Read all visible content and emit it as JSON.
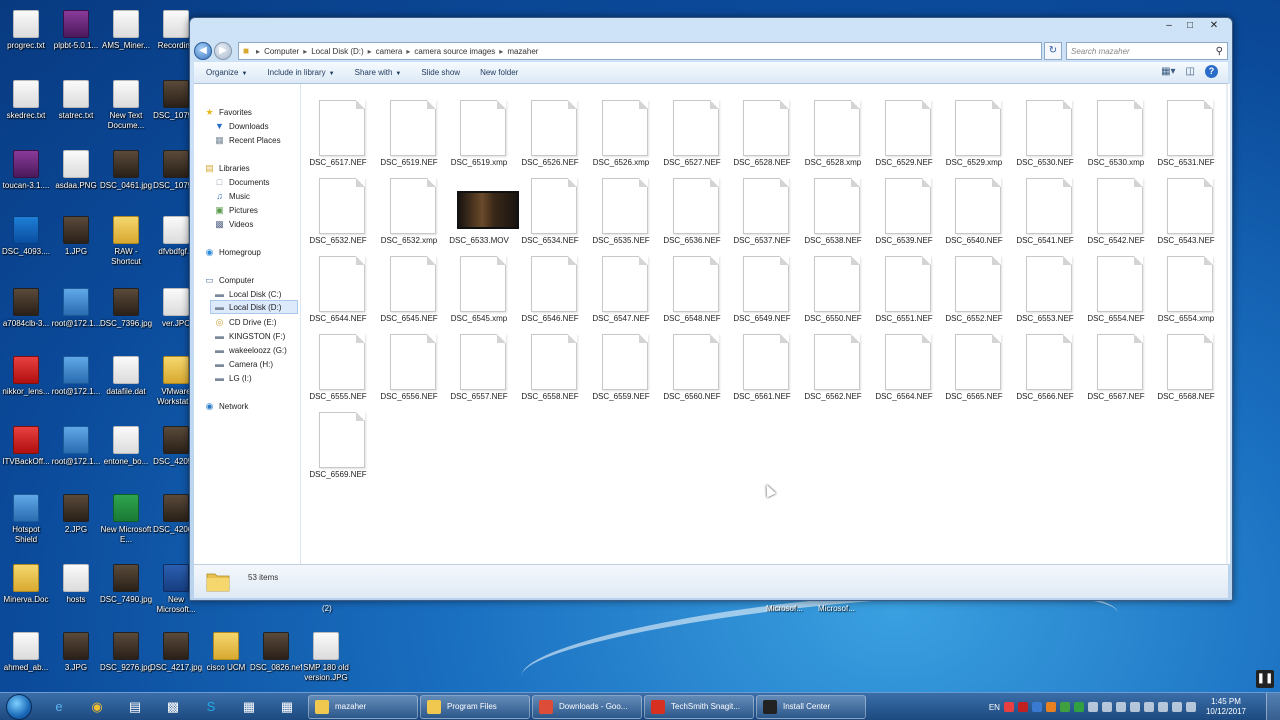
{
  "desktop": {
    "icons": [
      {
        "label": "progrec.txt",
        "kind": ""
      },
      {
        "label": "skedrec.txt",
        "kind": ""
      },
      {
        "label": "toucan-3.1....",
        "kind": "rar"
      },
      {
        "label": "DSC_4093....",
        "kind": "blue"
      },
      {
        "label": "a7084clb-3...",
        "kind": "photo"
      },
      {
        "label": "nikkor_lens...",
        "kind": "pdf"
      },
      {
        "label": "ITVBackOff...",
        "kind": "pdf"
      },
      {
        "label": "Hotspot Shield",
        "kind": "net"
      },
      {
        "label": "Minerva.Doc",
        "kind": "folder"
      },
      {
        "label": "ahmed_ab...",
        "kind": ""
      },
      {
        "label": "plpbt-5.0.1...",
        "kind": "rar"
      },
      {
        "label": "statrec.txt",
        "kind": ""
      },
      {
        "label": "asdaa.PNG",
        "kind": ""
      },
      {
        "label": "1.JPG",
        "kind": "photo"
      },
      {
        "label": "root@172.1...",
        "kind": "net"
      },
      {
        "label": "root@172.1...",
        "kind": "net"
      },
      {
        "label": "root@172.1...",
        "kind": "net"
      },
      {
        "label": "2.JPG",
        "kind": "photo"
      },
      {
        "label": "hosts",
        "kind": ""
      },
      {
        "label": "3.JPG",
        "kind": "photo"
      },
      {
        "label": "AMS_Miner...",
        "kind": ""
      },
      {
        "label": "New Text Docume...",
        "kind": ""
      },
      {
        "label": "DSC_0461.jpg",
        "kind": "photo"
      },
      {
        "label": "RAW - Shortcut",
        "kind": "folder"
      },
      {
        "label": "DSC_7396.jpg",
        "kind": "photo"
      },
      {
        "label": "datafile.dat",
        "kind": ""
      },
      {
        "label": "entone_bo...",
        "kind": ""
      },
      {
        "label": "New Microsoft E...",
        "kind": "green"
      },
      {
        "label": "DSC_7490.jpg",
        "kind": "photo"
      },
      {
        "label": "DSC_9276.jpg",
        "kind": "photo"
      },
      {
        "label": "Recording",
        "kind": ""
      },
      {
        "label": "DSC_1079...",
        "kind": "photo"
      },
      {
        "label": "DSC_1079...",
        "kind": "photo"
      },
      {
        "label": "dfvbdfgf...",
        "kind": ""
      },
      {
        "label": "ver.JPC",
        "kind": ""
      },
      {
        "label": "VMware Workstat...",
        "kind": "folder"
      },
      {
        "label": "DSC_4205...",
        "kind": "photo"
      },
      {
        "label": "DSC_4206...",
        "kind": "photo"
      },
      {
        "label": "New Microsoft...",
        "kind": "word"
      },
      {
        "label": "DSC_4217.jpg",
        "kind": "photo"
      },
      {
        "label": "cisco UCM",
        "kind": "folder"
      },
      {
        "label": "DSC_0826.nef",
        "kind": "photo"
      },
      {
        "label": "SMP 180 old version.JPG",
        "kind": ""
      }
    ],
    "behind_labels": [
      "(2)",
      "Microsof...",
      "Microsof..."
    ]
  },
  "window": {
    "controls": {
      "minimize": "–",
      "maximize": "□",
      "close": "✕"
    },
    "breadcrumb": [
      "Computer",
      "Local Disk (D:)",
      "camera",
      "camera source images",
      "mazaher"
    ],
    "search_placeholder": "Search mazaher",
    "toolbar": {
      "organize": "Organize",
      "include_in_library": "Include in library",
      "share_with": "Share with",
      "slide_show": "Slide show",
      "new_folder": "New folder"
    },
    "nav": {
      "favorites": "Favorites",
      "downloads": "Downloads",
      "recent_places": "Recent Places",
      "libraries": "Libraries",
      "documents": "Documents",
      "music": "Music",
      "pictures": "Pictures",
      "videos": "Videos",
      "homegroup": "Homegroup",
      "computer": "Computer",
      "local_c": "Local Disk (C:)",
      "local_d": "Local Disk (D:)",
      "cd_drive": "CD Drive (E:)",
      "kingston": "KINGSTON (F:)",
      "wakeeloozz": "wakeeloozz (G:)",
      "camera": "Camera (H:)",
      "lg": "LG (I:)",
      "network": "Network"
    },
    "files": [
      "DSC_6517.NEF",
      "DSC_6519.NEF",
      "DSC_6519.xmp",
      "DSC_6526.NEF",
      "DSC_6526.xmp",
      "DSC_6527.NEF",
      "DSC_6528.NEF",
      "DSC_6528.xmp",
      "DSC_6529.NEF",
      "DSC_6529.xmp",
      "DSC_6530.NEF",
      "DSC_6530.xmp",
      "DSC_6531.NEF",
      "DSC_6532.NEF",
      "DSC_6532.xmp",
      "DSC_6533.MOV",
      "DSC_6534.NEF",
      "DSC_6535.NEF",
      "DSC_6536.NEF",
      "DSC_6537.NEF",
      "DSC_6538.NEF",
      "DSC_6539.NEF",
      "DSC_6540.NEF",
      "DSC_6541.NEF",
      "DSC_6542.NEF",
      "DSC_6543.NEF",
      "DSC_6544.NEF",
      "DSC_6545.NEF",
      "DSC_6545.xmp",
      "DSC_6546.NEF",
      "DSC_6547.NEF",
      "DSC_6548.NEF",
      "DSC_6549.NEF",
      "DSC_6550.NEF",
      "DSC_6551.NEF",
      "DSC_6552.NEF",
      "DSC_6553.NEF",
      "DSC_6554.NEF",
      "DSC_6554.xmp",
      "DSC_6555.NEF",
      "DSC_6556.NEF",
      "DSC_6557.NEF",
      "DSC_6558.NEF",
      "DSC_6559.NEF",
      "DSC_6560.NEF",
      "DSC_6561.NEF",
      "DSC_6562.NEF",
      "DSC_6564.NEF",
      "DSC_6565.NEF",
      "DSC_6566.NEF",
      "DSC_6567.NEF",
      "DSC_6568.NEF",
      "DSC_6569.NEF"
    ],
    "video_file": "DSC_6533.MOV",
    "status": "53 items"
  },
  "taskbar": {
    "tasks": [
      {
        "label": "mazaher",
        "color": "#f0c850"
      },
      {
        "label": "Program Files",
        "color": "#f0c850"
      },
      {
        "label": "Downloads - Goo...",
        "color": "#dd4b39"
      },
      {
        "label": "TechSmith Snagit...",
        "color": "#d83020"
      },
      {
        "label": "Install Center",
        "color": "#222222"
      }
    ],
    "language": "EN",
    "time": "1:45 PM",
    "date": "10/12/2017"
  }
}
